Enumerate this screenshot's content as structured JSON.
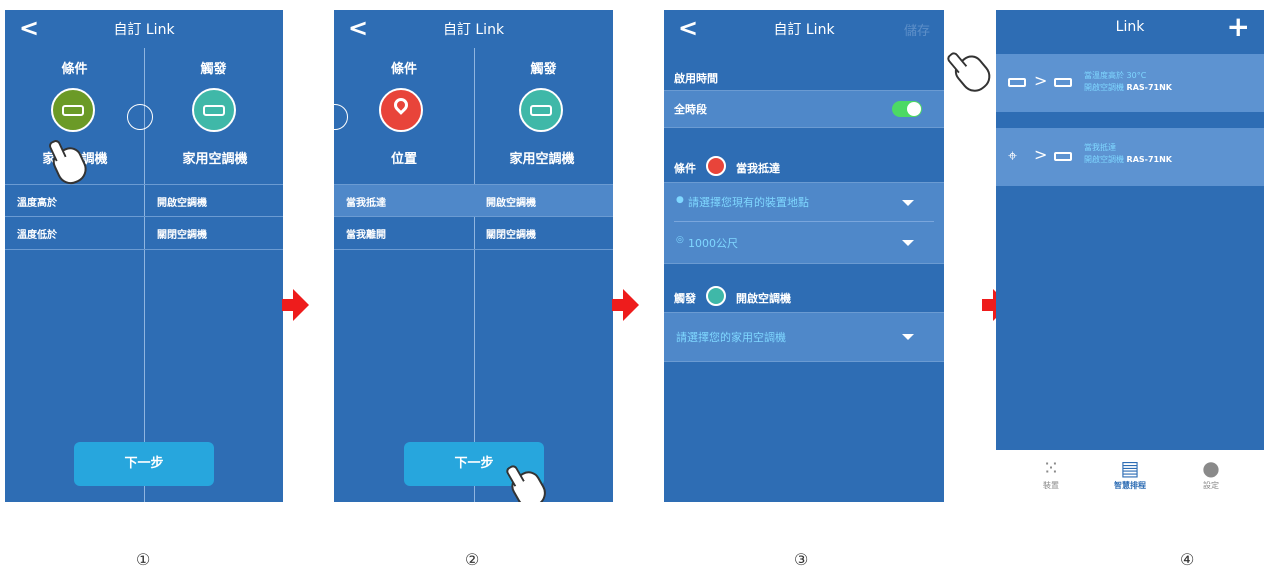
{
  "screen1": {
    "back_icon": "<",
    "title": "自訂 Link",
    "condition_label": "條件",
    "trigger_label": "觸發",
    "condition_device": "家用空調機",
    "trigger_device": "家用空調機",
    "rows": [
      {
        "left": "溫度高於",
        "right": "開啟空調機"
      },
      {
        "left": "溫度低於",
        "right": "關閉空調機"
      }
    ],
    "next_button": "下一步"
  },
  "screen2": {
    "back_icon": "<",
    "title": "自訂 Link",
    "condition_label": "條件",
    "trigger_label": "觸發",
    "condition_device": "位置",
    "trigger_device": "家用空調機",
    "rows": [
      {
        "left": "當我抵達",
        "right": "開啟空調機"
      },
      {
        "left": "當我離開",
        "right": "關閉空調機"
      }
    ],
    "next_button": "下一步"
  },
  "screen3": {
    "back_icon": "<",
    "title": "自訂 Link",
    "save": "儲存",
    "active_time_label": "啟用時間",
    "all_day": "全時段",
    "condition_label": "條件",
    "condition_value": "當我抵達",
    "location_placeholder": "請選擇您現有的裝置地點",
    "radius": "1000公尺",
    "trigger_label": "觸發",
    "trigger_value": "開啟空調機",
    "ac_placeholder": "請選擇您的家用空調機"
  },
  "screen4": {
    "title": "Link",
    "plus_icon": "+",
    "items": [
      {
        "line1": "當溫度高於 30°C",
        "line2_prefix": "開啟空調機",
        "model": "RAS-71NK"
      },
      {
        "line1": "當我抵達",
        "line2_prefix": "開啟空調機",
        "model": "RAS-71NK"
      }
    ],
    "tabs": [
      {
        "label": "裝置",
        "icon": "grid-icon"
      },
      {
        "label": "智慧排程",
        "icon": "schedule-icon"
      },
      {
        "label": "設定",
        "icon": "user-icon"
      }
    ]
  },
  "step_numbers": [
    "①",
    "②",
    "③",
    "④"
  ],
  "colors": {
    "screen_bg": "#2e6db4",
    "ac_green": "#6b9a27",
    "teal": "#3fb8a8",
    "location_red": "#e8443a",
    "button_blue": "#27a6dd",
    "arrow_red": "#ee1c1c",
    "toggle_green": "#4cd964"
  }
}
